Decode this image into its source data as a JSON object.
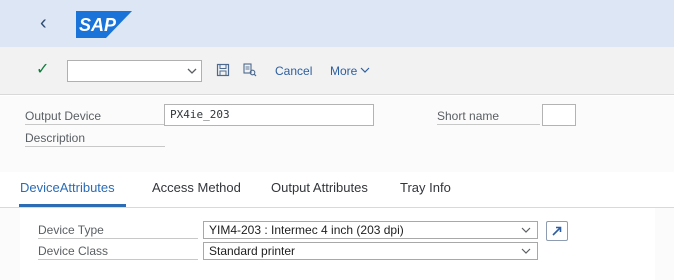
{
  "shell": {
    "logo_text": "SAP",
    "back_icon": "chevron-left-icon"
  },
  "toolbar": {
    "command_value": "",
    "cancel_label": "Cancel",
    "more_label": "More",
    "save_icon": "save-icon",
    "display_icon": "display-object-icon",
    "check_icon": "check-icon"
  },
  "form": {
    "output_device_label": "Output Device",
    "output_device_value": "PX4ie_203",
    "short_name_label": "Short name",
    "short_name_value": "",
    "description_label": "Description"
  },
  "tabs": [
    {
      "label": "DeviceAttributes",
      "active": true
    },
    {
      "label": "Access Method",
      "active": false
    },
    {
      "label": "Output Attributes",
      "active": false
    },
    {
      "label": "Tray Info",
      "active": false
    }
  ],
  "device_attributes": {
    "device_type_label": "Device Type",
    "device_type_value": "YIM4-203 : Intermec 4 inch (203 dpi)",
    "device_class_label": "Device Class",
    "device_class_value": "Standard printer"
  },
  "colors": {
    "shell_bg": "#dde6f4",
    "accent": "#2b6cb5",
    "sap_blue": "#0a6ed1",
    "check_green": "#107e3e"
  }
}
